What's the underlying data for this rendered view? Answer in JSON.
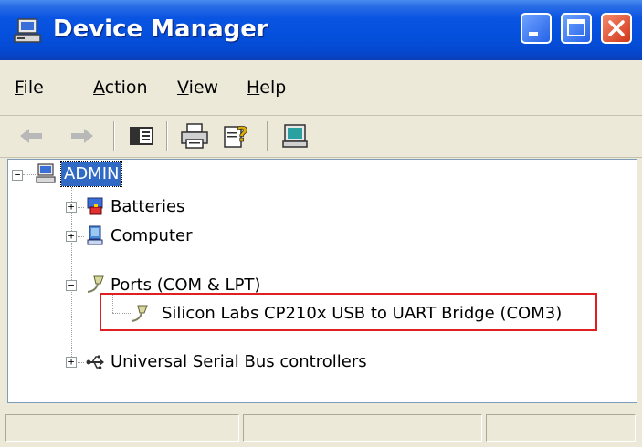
{
  "window": {
    "title": "Device Manager"
  },
  "menu": {
    "file": {
      "mnemonic": "F",
      "rest": "ile"
    },
    "action": {
      "mnemonic": "A",
      "rest": "ction"
    },
    "view": {
      "mnemonic": "V",
      "rest": "iew"
    },
    "help": {
      "mnemonic": "H",
      "rest": "elp"
    }
  },
  "toolbar": {
    "icons": [
      "back-arrow-icon",
      "forward-arrow-icon",
      "show-hide-console-tree-icon",
      "print-icon",
      "help-icon",
      "scan-hardware-icon"
    ]
  },
  "tree": {
    "root": {
      "label": "ADMIN",
      "expanded": true
    },
    "batteries": {
      "label": "Batteries",
      "expanded": false
    },
    "computer": {
      "label": "Computer",
      "expanded": false
    },
    "ports": {
      "label": "Ports (COM & LPT)",
      "expanded": true
    },
    "port_device": {
      "label": "Silicon Labs CP210x USB to UART Bridge (COM3)"
    },
    "usb": {
      "label": "Universal Serial Bus controllers",
      "expanded": false
    }
  },
  "colors": {
    "titlebar": "#0450dc",
    "selection": "#316ac5",
    "highlight_box": "#e02020",
    "window_face": "#ece9d8"
  }
}
